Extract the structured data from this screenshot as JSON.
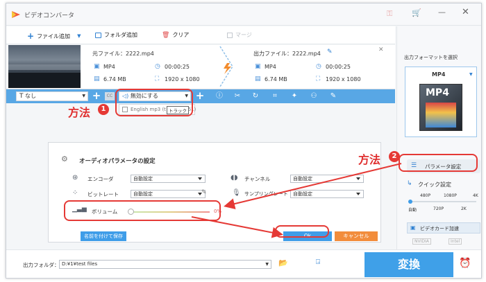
{
  "titlebar": {
    "app_title": "ビデオコンバータ"
  },
  "toolbar": {
    "add_file": "ファイル追加",
    "add_folder": "フォルダ追加",
    "clear": "クリア",
    "merge": "マージ"
  },
  "file": {
    "source_label": "元ファイル：2222.mp4",
    "output_label": "出力ファイル：2222.mp4",
    "src_format": "MP4",
    "src_duration": "00:00:25",
    "src_size": "6.74 MB",
    "src_resolution": "1920 x 1080",
    "out_format": "MP4",
    "out_duration": "00:00:25",
    "out_size": "6.74 MB",
    "out_resolution": "1920 x 1080"
  },
  "bluebar": {
    "subtitle_value": "なし",
    "audio_value": "無効にする",
    "track_item": "English mp3 (t",
    "track_suffix": "0x61)",
    "tooltip": "トラック"
  },
  "annotations": {
    "method1": "方法",
    "method2": "方法",
    "num1": "1",
    "num2": "2"
  },
  "dialog": {
    "title": "オーディオパラメータの設定",
    "encoder_label": "エンコーダ",
    "encoder_value": "自動設定",
    "bitrate_label": "ビットレート",
    "bitrate_value": "自動設定",
    "channel_label": "チャンネル",
    "channel_value": "自動設定",
    "samplerate_label": "サンプリングレート",
    "samplerate_value": "自動設定",
    "volume_label": "ボリューム",
    "volume_value": "0%",
    "volume_level": 0,
    "save_as": "名前を付けて保存",
    "ok": "Ok",
    "cancel": "キャンセル"
  },
  "rightpanel": {
    "format_header": "出力フォーマットを選択",
    "format_value": "MP4",
    "format_icon_text": "MP4",
    "param_button": "パラメータ設定",
    "quick_setting": "クイック設定",
    "q_top": [
      "480P",
      "1080P",
      "4K"
    ],
    "q_bottom": [
      "自動",
      "720P",
      "2K"
    ],
    "accel": "ビデオカード加速",
    "nvidia": "NVIDIA",
    "intel": "Intel"
  },
  "bottom": {
    "folder_label": "出力フォルダ：",
    "folder_path": "D:¥1¥test files",
    "convert": "変換"
  },
  "colors": {
    "accent": "#3fa0e8",
    "orange": "#f5913a",
    "red": "#e53935"
  }
}
